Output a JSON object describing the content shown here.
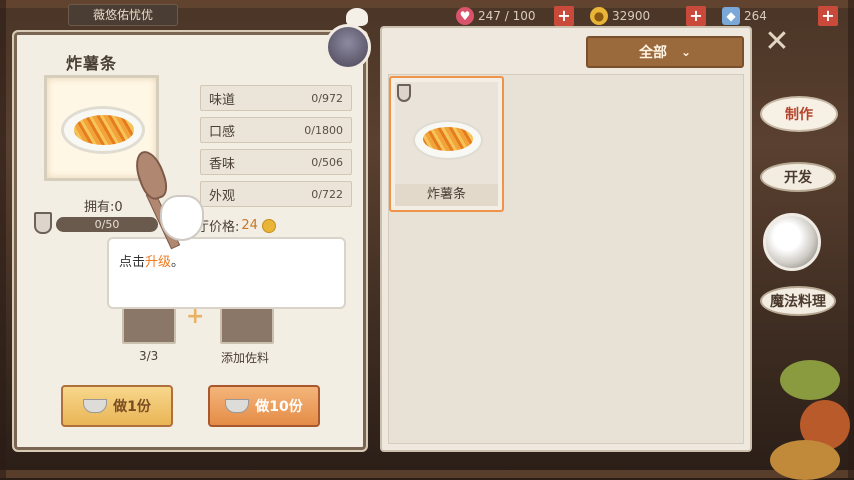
{
  "top_tab": "薇悠佑忧优",
  "resources": {
    "stamina": {
      "icon": "heart-icon",
      "value": "247 / 100"
    },
    "gold": {
      "icon": "coin-icon",
      "value": "32900"
    },
    "gem": {
      "icon": "gem-icon",
      "value": "264"
    }
  },
  "recipe": {
    "title": "炸薯条",
    "own_label": "拥有:0",
    "progress_text": "0/50",
    "progress_value": 0,
    "stats": [
      {
        "label": "味道",
        "value": "0/972"
      },
      {
        "label": "口感",
        "value": "0/1800"
      },
      {
        "label": "香味",
        "value": "0/506"
      },
      {
        "label": "外观",
        "value": "0/722"
      }
    ],
    "price_label": "厅价格:",
    "price_value": "24",
    "ingredient_count": "3/3",
    "seasoning_label": "添加佐料",
    "cook_one": "做1份",
    "cook_ten": "做10份"
  },
  "tooltip": {
    "prefix": "点击",
    "highlight": "升级",
    "suffix": "。"
  },
  "list": {
    "filter_label": "全部",
    "cards": [
      {
        "name": "炸薯条"
      }
    ]
  },
  "side_menu": {
    "cook": "制作",
    "develop": "开发",
    "magic": "魔法料理"
  },
  "colors": {
    "accent_orange": "#f07a1e",
    "panel": "#f3eee4",
    "button_brown": "#9a6a3c"
  }
}
